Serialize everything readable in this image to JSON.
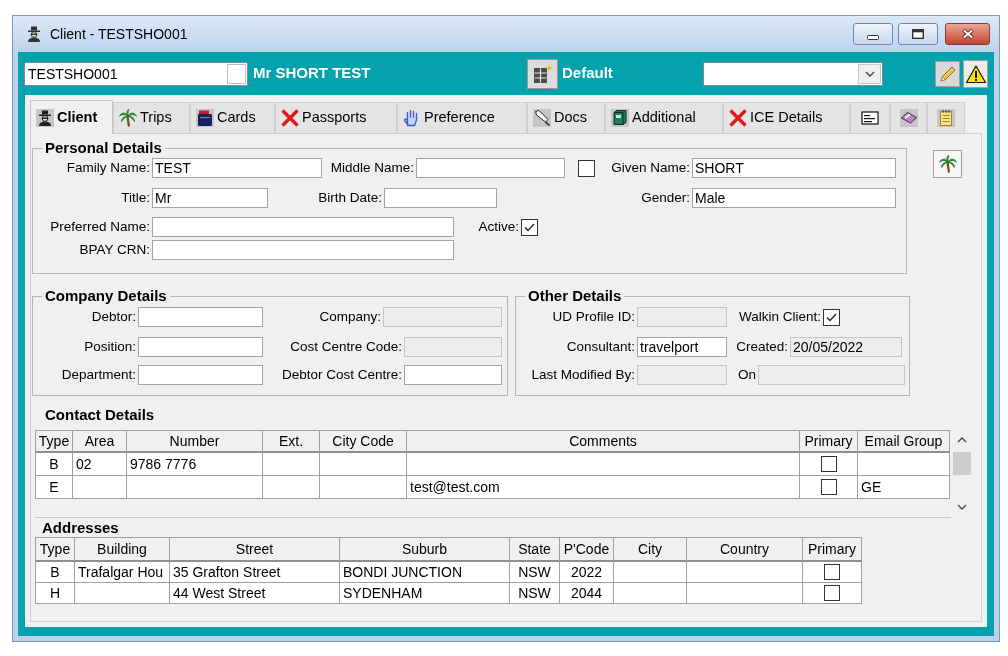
{
  "window": {
    "title": "Client - TESTSHO001"
  },
  "header": {
    "client_code": "TESTSHO001",
    "code_flag_checked": false,
    "client_name": "Mr SHORT TEST",
    "profile": "Default"
  },
  "tabs": [
    {
      "kind": "label",
      "label": "Client",
      "selected": true
    },
    {
      "kind": "label",
      "label": "Trips",
      "selected": false
    },
    {
      "kind": "label",
      "label": "Cards",
      "selected": false
    },
    {
      "kind": "label",
      "label": "Passports",
      "selected": false
    },
    {
      "kind": "label",
      "label": "Preference",
      "selected": false
    },
    {
      "kind": "label",
      "label": "Docs",
      "selected": false
    },
    {
      "kind": "label",
      "label": "Additional",
      "selected": false
    },
    {
      "kind": "label",
      "label": "ICE Details",
      "selected": false
    },
    {
      "kind": "icon",
      "selected": false
    },
    {
      "kind": "icon",
      "selected": false
    },
    {
      "kind": "icon",
      "selected": false
    }
  ],
  "personal_details": {
    "title": "Personal Details",
    "rows": [
      [
        {
          "kind": "field",
          "label": "Family Name:",
          "value": "TEST"
        },
        {
          "kind": "field",
          "label": "Middle Name:"
        },
        {
          "kind": "checkbox",
          "checked": false
        },
        {
          "kind": "field",
          "label": "Given Name:",
          "value": "SHORT"
        }
      ],
      [
        {
          "kind": "field",
          "label": "Title:",
          "value": "Mr"
        },
        {
          "kind": "field",
          "label": "Birth Date:"
        },
        {
          "kind": "field",
          "label": "Gender:",
          "value": "Male"
        }
      ],
      [
        {
          "kind": "field",
          "label": "Preferred Name:"
        },
        {
          "kind": "checkbox",
          "label": "Active:",
          "checked": true
        }
      ],
      [
        {
          "kind": "field",
          "label": "BPAY CRN:"
        }
      ]
    ]
  },
  "company_details": {
    "title": "Company Details",
    "rows": [
      [
        {
          "kind": "field",
          "label": "Debtor:",
          "disabled": false
        },
        {
          "kind": "field",
          "label": "Company:",
          "disabled": true
        }
      ],
      [
        {
          "kind": "field",
          "label": "Position:",
          "disabled": false
        },
        {
          "kind": "field",
          "label": "Cost Centre Code:",
          "disabled": true
        }
      ],
      [
        {
          "kind": "field",
          "label": "Department:",
          "disabled": false
        },
        {
          "kind": "field",
          "label": "Debtor Cost Centre:",
          "disabled": false
        }
      ]
    ]
  },
  "other_details": {
    "title": "Other Details",
    "rows": [
      [
        {
          "kind": "field",
          "label": "UD Profile ID:",
          "disabled": true
        },
        {
          "kind": "checkbox",
          "label": "Walkin Client:",
          "checked": true
        }
      ],
      [
        {
          "kind": "field",
          "label": "Consultant:",
          "value": "travelport",
          "disabled": false
        },
        {
          "kind": "field",
          "label": "Created:",
          "value": "20/05/2022",
          "disabled": true
        }
      ],
      [
        {
          "kind": "field",
          "label": "Last Modified By:",
          "disabled": true
        },
        {
          "kind": "field",
          "label": "On",
          "disabled": true
        }
      ]
    ]
  },
  "contact_details": {
    "title": "Contact Details",
    "columns": [
      "Type",
      "Area",
      "Number",
      "Ext.",
      "City Code",
      "Comments",
      "Primary",
      "Email Group"
    ],
    "rows": [
      {
        "type": "B",
        "area": "02",
        "number": "9786 7776",
        "primary": false
      },
      {
        "type": "E",
        "comments": "test@test.com",
        "primary": false,
        "email_group": "GE"
      }
    ]
  },
  "addresses": {
    "title": "Addresses",
    "columns": [
      "Type",
      "Building",
      "Street",
      "Suburb",
      "State",
      "P'Code",
      "City",
      "Country",
      "Primary"
    ],
    "rows": [
      {
        "type": "B",
        "building": "Trafalgar Hou",
        "street": "35 Grafton Street",
        "suburb": "BONDI JUNCTION",
        "state": "NSW",
        "postcode": "2022",
        "primary": false
      },
      {
        "type": "H",
        "street": "44 West Street",
        "suburb": "SYDENHAM",
        "state": "NSW",
        "postcode": "2044",
        "primary": false
      }
    ]
  }
}
